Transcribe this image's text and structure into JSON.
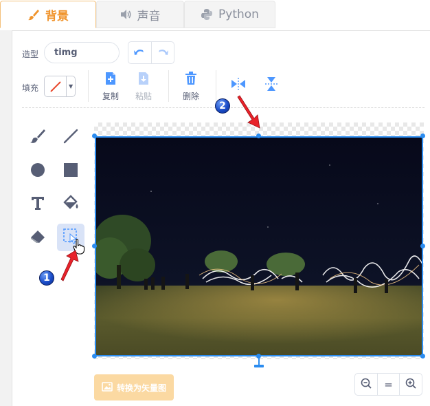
{
  "tabs": [
    {
      "label": "背景",
      "icon": "brush-icon",
      "active": true
    },
    {
      "label": "声音",
      "icon": "speaker-icon",
      "active": false
    },
    {
      "label": "Python",
      "icon": "python-icon",
      "active": false
    }
  ],
  "costume": {
    "label": "造型",
    "name_value": "timg"
  },
  "fill": {
    "label": "填充",
    "swatch": "none-slash"
  },
  "actions": {
    "copy": "复制",
    "paste": "粘贴",
    "delete": "删除"
  },
  "flip_icons": [
    "flip-horizontal-icon",
    "flip-vertical-icon"
  ],
  "tools": [
    "brush-icon",
    "line-icon",
    "circle-icon",
    "rectangle-icon",
    "text-icon",
    "fill-bucket-icon",
    "eraser-icon",
    "select-icon"
  ],
  "selected_tool": "select-icon",
  "convert_button": "转换为矢量图",
  "zoom": {
    "out": "zoom-out-icon",
    "reset": "=",
    "in": "zoom-in-icon"
  },
  "annotations": [
    {
      "number": "1"
    },
    {
      "number": "2"
    }
  ],
  "colors": {
    "accent": "#f0932b",
    "tool_blue": "#4d97ff",
    "selection": "#2b8cf0",
    "annotation_red": "#e8222a"
  }
}
